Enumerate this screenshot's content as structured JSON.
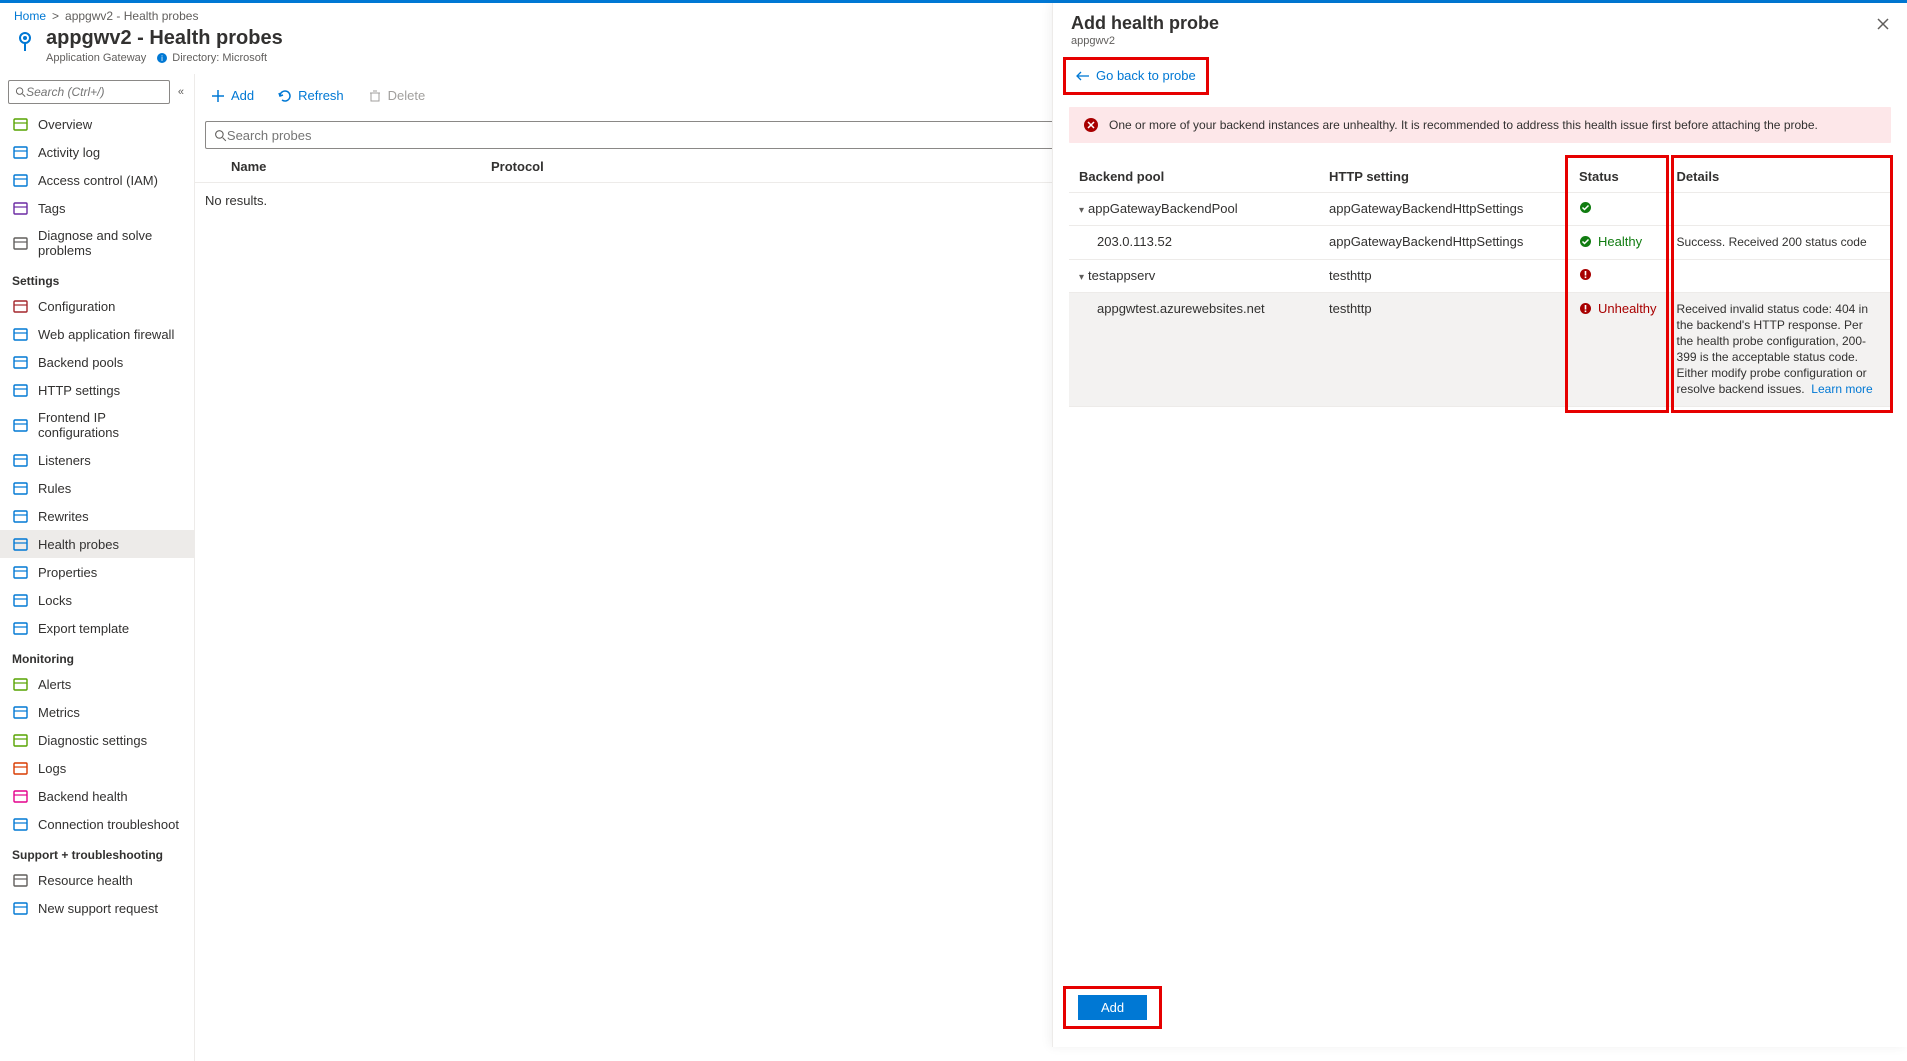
{
  "breadcrumb": {
    "home": "Home",
    "resource": "appgwv2 - Health probes"
  },
  "header": {
    "title": "appgwv2 - Health probes",
    "type": "Application Gateway",
    "directory_label": "Directory: Microsoft"
  },
  "sidebar": {
    "search_placeholder": "Search (Ctrl+/)",
    "items": [
      {
        "icon": "overview",
        "label": "Overview",
        "color": "#57a300"
      },
      {
        "icon": "activity",
        "label": "Activity log",
        "color": "#0078d4"
      },
      {
        "icon": "iam",
        "label": "Access control (IAM)",
        "color": "#0078d4"
      },
      {
        "icon": "tags",
        "label": "Tags",
        "color": "#6b2aa3"
      },
      {
        "icon": "diagnose",
        "label": "Diagnose and solve problems",
        "color": "#605e5c"
      }
    ],
    "groups": [
      {
        "title": "Settings",
        "items": [
          {
            "icon": "config",
            "label": "Configuration",
            "color": "#a4262c"
          },
          {
            "icon": "waf",
            "label": "Web application firewall",
            "color": "#0078d4"
          },
          {
            "icon": "backend",
            "label": "Backend pools",
            "color": "#0078d4"
          },
          {
            "icon": "http",
            "label": "HTTP settings",
            "color": "#0078d4"
          },
          {
            "icon": "frontend",
            "label": "Frontend IP configurations",
            "color": "#0078d4"
          },
          {
            "icon": "listeners",
            "label": "Listeners",
            "color": "#0078d4"
          },
          {
            "icon": "rules",
            "label": "Rules",
            "color": "#0078d4"
          },
          {
            "icon": "rewrites",
            "label": "Rewrites",
            "color": "#0078d4"
          },
          {
            "icon": "probes",
            "label": "Health probes",
            "color": "#0078d4",
            "selected": true
          },
          {
            "icon": "props",
            "label": "Properties",
            "color": "#0078d4"
          },
          {
            "icon": "locks",
            "label": "Locks",
            "color": "#0078d4"
          },
          {
            "icon": "export",
            "label": "Export template",
            "color": "#0078d4"
          }
        ]
      },
      {
        "title": "Monitoring",
        "items": [
          {
            "icon": "alerts",
            "label": "Alerts",
            "color": "#57a300"
          },
          {
            "icon": "metrics",
            "label": "Metrics",
            "color": "#0078d4"
          },
          {
            "icon": "diag",
            "label": "Diagnostic settings",
            "color": "#57a300"
          },
          {
            "icon": "logs",
            "label": "Logs",
            "color": "#d83b01"
          },
          {
            "icon": "health",
            "label": "Backend health",
            "color": "#e3008c"
          },
          {
            "icon": "trouble",
            "label": "Connection troubleshoot",
            "color": "#0078d4"
          }
        ]
      },
      {
        "title": "Support + troubleshooting",
        "items": [
          {
            "icon": "reshealth",
            "label": "Resource health",
            "color": "#605e5c"
          },
          {
            "icon": "support",
            "label": "New support request",
            "color": "#0078d4"
          }
        ]
      }
    ]
  },
  "toolbar": {
    "add": "Add",
    "refresh": "Refresh",
    "delete": "Delete"
  },
  "main": {
    "search_placeholder": "Search probes",
    "col_name": "Name",
    "col_protocol": "Protocol",
    "empty": "No results."
  },
  "blade": {
    "title": "Add health probe",
    "subtitle": "appgwv2",
    "back": "Go back to probe",
    "alert": "One or more of your backend instances are unhealthy. It is recommended to address this health issue first before attaching the probe.",
    "columns": {
      "pool": "Backend pool",
      "http": "HTTP setting",
      "status": "Status",
      "details": "Details"
    },
    "rows": [
      {
        "type": "group",
        "pool": "appGatewayBackendPool",
        "http": "appGatewayBackendHttpSettings",
        "status": "ok"
      },
      {
        "type": "child",
        "pool": "203.0.113.52",
        "http": "appGatewayBackendHttpSettings",
        "status": "ok",
        "status_text": "Healthy",
        "details": "Success. Received 200 status code"
      },
      {
        "type": "group",
        "pool": "testappserv",
        "http": "testhttp",
        "status": "bad"
      },
      {
        "type": "child-sel",
        "pool": "appgwtest.azurewebsites.net",
        "http": "testhttp",
        "status": "bad",
        "status_text": "Unhealthy",
        "details": "Received invalid status code: 404 in the backend's HTTP response. Per the health probe configuration, 200-399 is the acceptable status code. Either modify probe configuration or resolve backend issues.",
        "link": "Learn more"
      }
    ],
    "add_button": "Add"
  }
}
